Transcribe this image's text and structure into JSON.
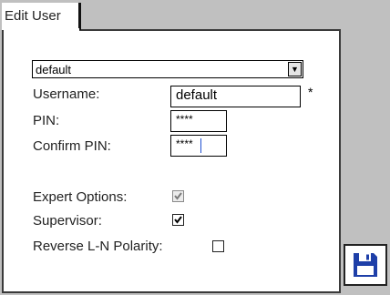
{
  "tab": {
    "label": "Edit User"
  },
  "user_select": {
    "value": "default"
  },
  "form": {
    "username_label": "Username:",
    "username_value": "default",
    "required_mark": "*",
    "pin_label": "PIN:",
    "pin_value": "****",
    "confirm_pin_label": "Confirm PIN:",
    "confirm_pin_value": "****",
    "expert_options_label": "Expert Options:",
    "expert_options_checked": true,
    "expert_options_enabled": false,
    "supervisor_label": "Supervisor:",
    "supervisor_checked": true,
    "reverse_polarity_label": "Reverse L-N Polarity:",
    "reverse_polarity_checked": false
  },
  "icons": {
    "dropdown": "chevron-down-icon",
    "save": "floppy-disk-icon"
  },
  "colors": {
    "save_icon": "#1e3fa8",
    "caret": "#2050d0"
  }
}
